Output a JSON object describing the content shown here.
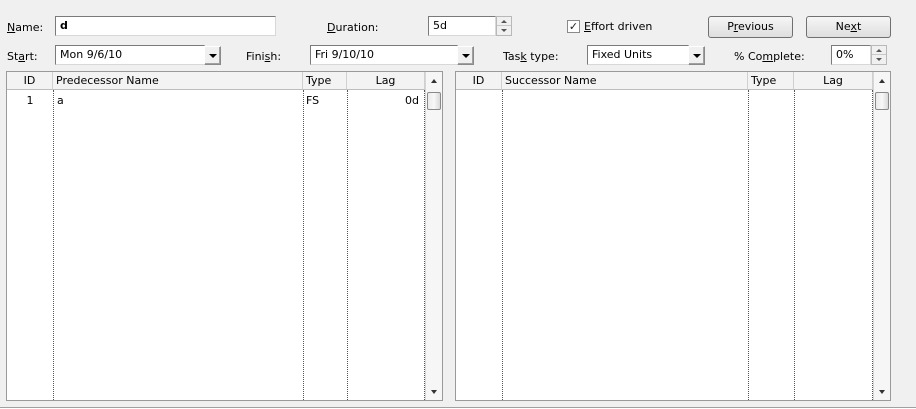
{
  "form": {
    "name_label_pre": "",
    "name_label_u": "N",
    "name_label_post": "ame:",
    "name_value": "d",
    "duration_label_u": "D",
    "duration_label_post": "uration:",
    "duration_value": "5d",
    "effort_driven_checked": true,
    "effort_driven_check_glyph": "✓",
    "effort_label_u": "E",
    "effort_label_post": "ffort driven",
    "previous_pre": "P",
    "previous_u": "r",
    "previous_post": "evious",
    "next_pre": "Ne",
    "next_u": "x",
    "next_post": "t",
    "start_label_pre": "St",
    "start_label_u": "a",
    "start_label_post": "rt:",
    "start_value": "Mon 9/6/10",
    "finish_label_pre": "Fini",
    "finish_label_u": "s",
    "finish_label_post": "h:",
    "finish_value": "Fri 9/10/10",
    "task_type_label_pre": "Tas",
    "task_type_label_u": "k",
    "task_type_label_post": " type:",
    "task_type_value": "Fixed Units",
    "complete_label_pre": "% Co",
    "complete_label_u": "m",
    "complete_label_post": "plete:",
    "complete_value": "0%"
  },
  "predecessors": {
    "headers": {
      "id": "ID",
      "name": "Predecessor Name",
      "type": "Type",
      "lag": "Lag"
    },
    "rows": [
      {
        "id": "1",
        "name": "a",
        "type": "FS",
        "lag": "0d"
      }
    ]
  },
  "successors": {
    "headers": {
      "id": "ID",
      "name": "Successor Name",
      "type": "Type",
      "lag": "Lag"
    },
    "rows": []
  }
}
